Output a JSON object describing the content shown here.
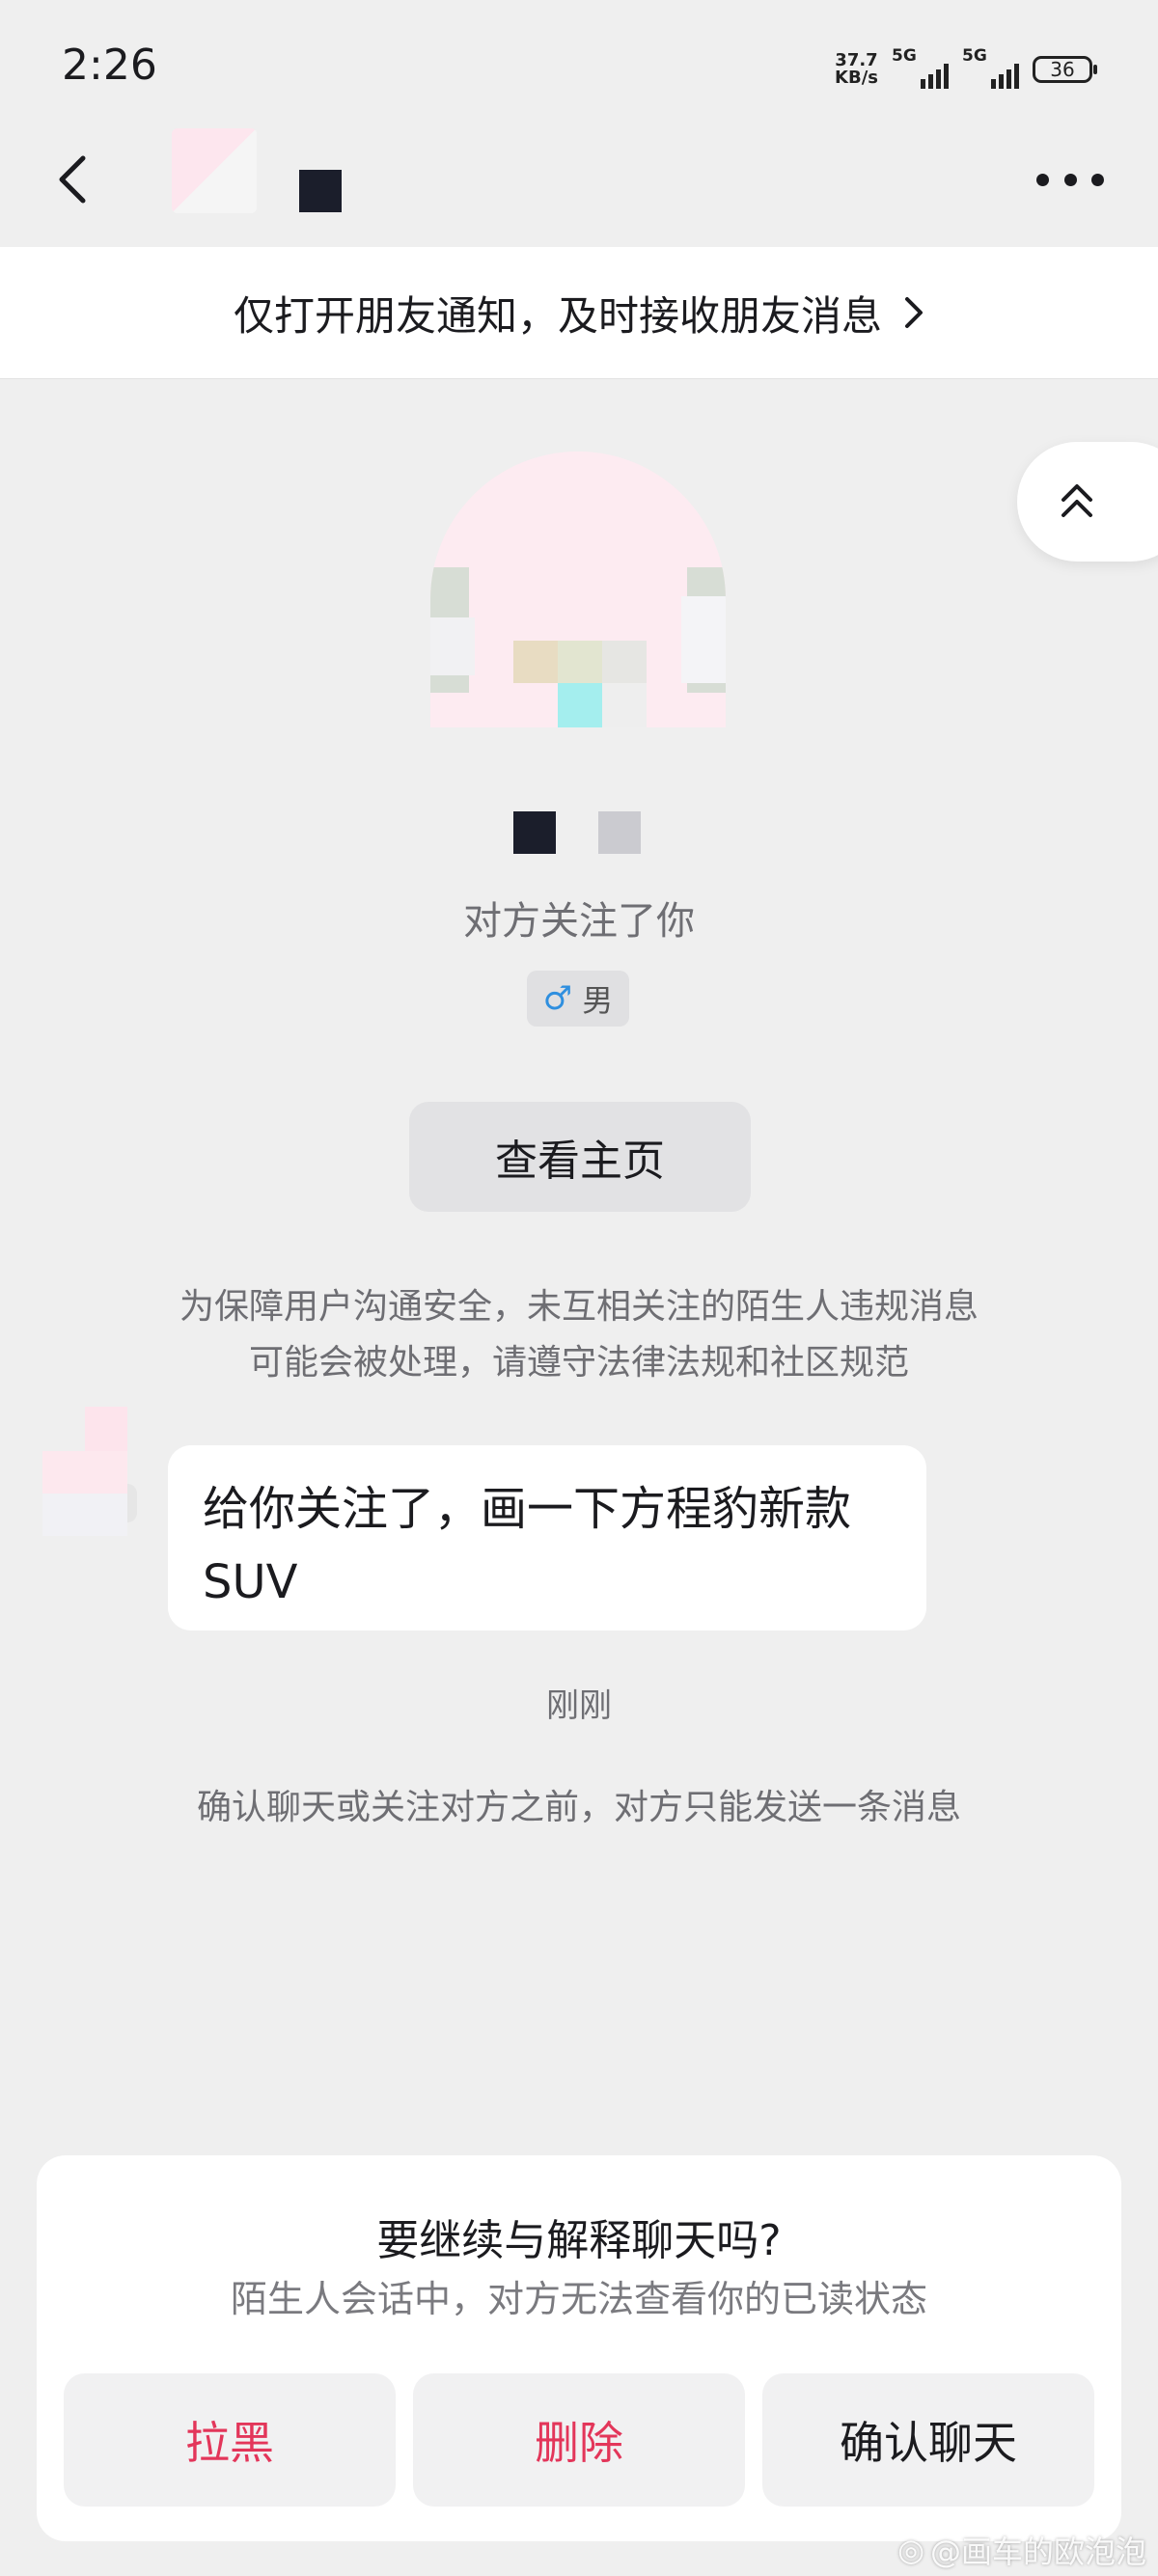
{
  "status_bar": {
    "time": "2:26",
    "net_speed_value": "37.7",
    "net_speed_unit": "KB/s",
    "sim1": "5G",
    "sim2": "5G",
    "battery": "36"
  },
  "header": {
    "back_icon": "chevron-left-icon",
    "more_icon": "more-horizontal-icon"
  },
  "notify_banner": {
    "text": "仅打开朋友通知，及时接收朋友消息",
    "icon": "chevron-right-icon"
  },
  "profile": {
    "follow_status": "对方关注了你",
    "gender_symbol": "♂",
    "gender": "男",
    "view_homepage": "查看主页"
  },
  "safety_notice": {
    "line1": "为保障用户沟通安全，未互相关注的陌生人违规消息",
    "line2": "可能会被处理，请遵守法律法规和社区规范"
  },
  "message": {
    "line1": "给你关注了，画一下方程豹新款",
    "line2": "SUV",
    "time": "刚刚"
  },
  "limit_notice": "确认聊天或关注对方之前，对方只能发送一条消息",
  "confirm_card": {
    "title": "要继续与解释聊天吗?",
    "subtitle": "陌生人会话中，对方无法查看你的已读状态",
    "buttons": {
      "block": "拉黑",
      "delete": "删除",
      "confirm": "确认聊天"
    },
    "colors": {
      "danger": "#e3365a"
    }
  },
  "watermark": "@画车的欧泡泡"
}
